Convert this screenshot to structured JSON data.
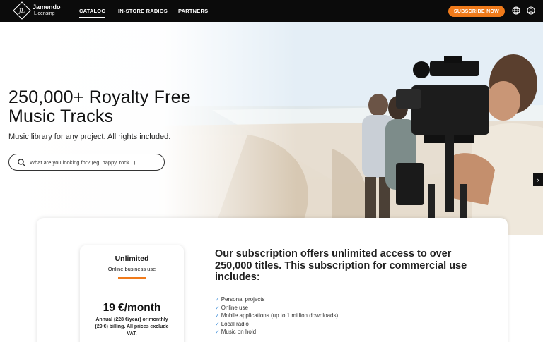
{
  "brand": {
    "name": "Jamendo",
    "subtitle": "Licensing"
  },
  "nav": {
    "items": [
      {
        "label": "CATALOG",
        "active": true
      },
      {
        "label": "IN-STORE RADIOS",
        "active": false
      },
      {
        "label": "PARTNERS",
        "active": false
      }
    ],
    "subscribe_label": "SUBSCRIBE NOW",
    "icons": [
      "globe-icon",
      "user-icon"
    ],
    "accent_color": "#f07a1a"
  },
  "hero": {
    "title": "250,000+ Royalty Free Music Tracks",
    "subtitle": "Music library for any project. All rights included.",
    "search_placeholder": "What are you looking for? (eg: happy, rock...)",
    "carousel_next_icon": "chevron-right-icon"
  },
  "plan": {
    "name": "Unlimited",
    "type": "Online business use",
    "price": "19 €/month",
    "billing": "Annual (228 €/year) or monthly (29 €) billing. All prices exclude VAT."
  },
  "offer": {
    "title": "Our subscription offers unlimited access to over 250,000 titles. This subscription for commercial use includes:",
    "features": [
      "Personal projects",
      "Online use",
      "Mobile applications (up to 1 million downloads)",
      "Local radio",
      "Music on hold"
    ],
    "check_icon": "check-icon",
    "check_color": "#3a8bd8"
  }
}
